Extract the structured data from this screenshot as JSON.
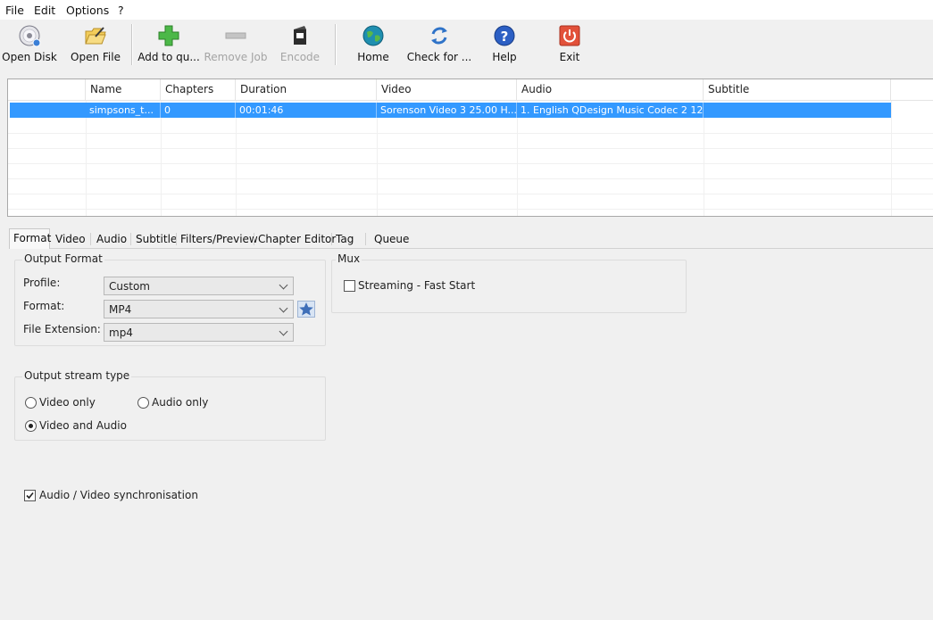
{
  "menu": [
    "File",
    "Edit",
    "Options",
    "?"
  ],
  "toolbar": {
    "open_disk": "Open Disk",
    "open_file": "Open File",
    "add_to_queue": "Add to qu...",
    "remove_job": "Remove Job",
    "encode": "Encode",
    "home": "Home",
    "check_for": "Check for ...",
    "help": "Help",
    "exit": "Exit"
  },
  "job_list": {
    "columns": [
      "Name",
      "Chapters",
      "Duration",
      "Video",
      "Audio",
      "Subtitle"
    ],
    "rows": [
      {
        "name": "simpsons_t...",
        "chapters": "0",
        "duration": "00:01:46",
        "video": "Sorenson Video 3 25.00 H...",
        "audio": "1. English QDesign Music Codec 2 12...",
        "subtitle": ""
      }
    ]
  },
  "tabs": [
    "Format",
    "Video",
    "Audio",
    "Subtitle",
    "Filters/Preview",
    "Chapter Editor",
    "Tag",
    "Queue"
  ],
  "active_tab": "Format",
  "output_format": {
    "title": "Output Format",
    "profile_label": "Profile:",
    "profile_value": "Custom",
    "format_label": "Format:",
    "format_value": "MP4",
    "extension_label": "File Extension:",
    "extension_value": "mp4"
  },
  "mux": {
    "title": "Mux",
    "streaming_label": "Streaming - Fast Start",
    "streaming_checked": false
  },
  "output_stream": {
    "title": "Output stream type",
    "video_only": "Video only",
    "audio_only": "Audio only",
    "video_and_audio": "Video and Audio",
    "selected": "video_and_audio"
  },
  "sync": {
    "label": "Audio / Video synchronisation",
    "checked": true
  },
  "colors": {
    "selection": "#3399ff",
    "window_bg": "#f0f0f0"
  }
}
